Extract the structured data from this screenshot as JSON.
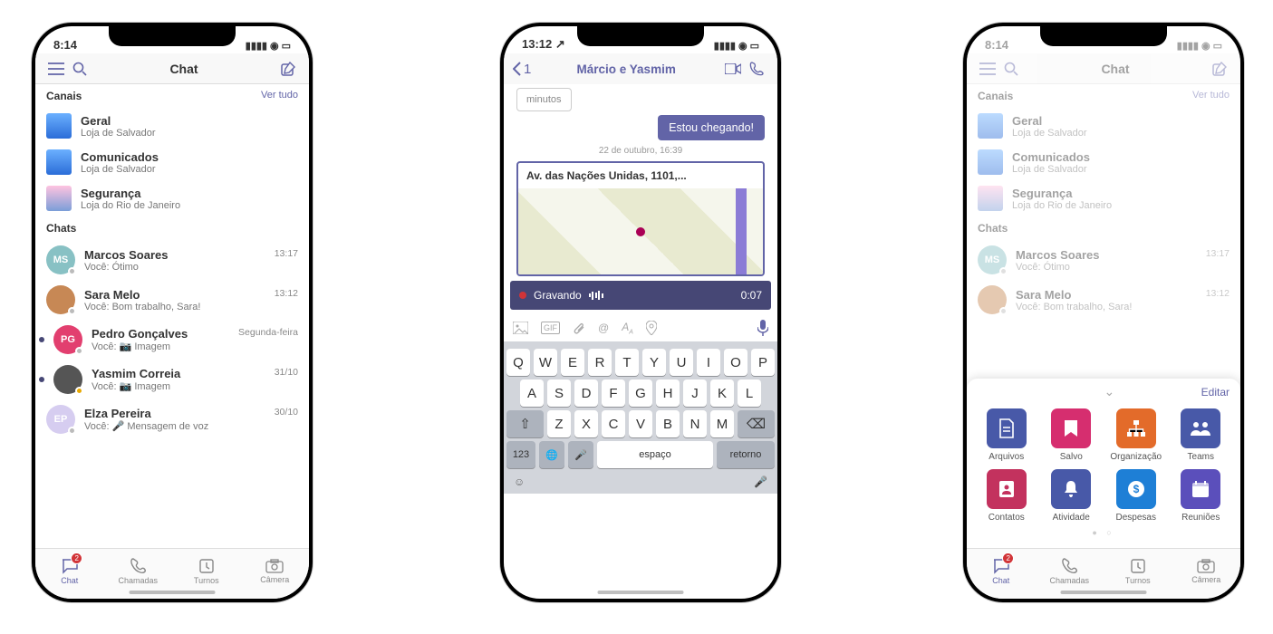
{
  "phone1": {
    "status_time": "8:14",
    "header_title": "Chat",
    "sections": {
      "channels_label": "Canais",
      "channels_link": "Ver tudo",
      "chats_label": "Chats"
    },
    "channels": [
      {
        "name": "Geral",
        "sub": "Loja de Salvador",
        "avatarClass": "blue"
      },
      {
        "name": "Comunicados",
        "sub": "Loja de Salvador",
        "avatarClass": "blue"
      },
      {
        "name": "Segurança",
        "sub": "Loja do Rio de Janeiro",
        "avatarClass": "pink"
      }
    ],
    "chats": [
      {
        "name": "Marcos Soares",
        "preview": "Você: Ótimo",
        "time": "13:17",
        "initials": "MS",
        "bg": "#88c1c4"
      },
      {
        "name": "Sara Melo",
        "preview": "Você: Bom trabalho, Sara!",
        "time": "13:12",
        "initials": "",
        "bg": "#c78855",
        "photo": true
      },
      {
        "name": "Pedro Gonçalves",
        "preview": "Você: 📷 Imagem",
        "time": "Segunda-feira",
        "initials": "PG",
        "bg": "#e23f6f",
        "dot": true
      },
      {
        "name": "Yasmim Correia",
        "preview": "Você: 📷 Imagem",
        "time": "31/10",
        "initials": "",
        "bg": "#555",
        "photo": true,
        "presence": "warn",
        "dot": true
      },
      {
        "name": "Elza Pereira",
        "preview": "Você: 🎤 Mensagem de voz",
        "time": "30/10",
        "initials": "EP",
        "bg": "#d6cdf0"
      }
    ],
    "tabs": [
      {
        "label": "Chat",
        "icon": "chat",
        "badge": "2",
        "active": true
      },
      {
        "label": "Chamadas",
        "icon": "call"
      },
      {
        "label": "Turnos",
        "icon": "shifts"
      },
      {
        "label": "Câmera",
        "icon": "camera"
      }
    ]
  },
  "phone2": {
    "status_time": "13:12",
    "back_count": "1",
    "header_title": "Márcio e Yasmim",
    "prev_bubble": "minutos",
    "sent_bubble": "Estou chegando!",
    "timestamp": "22 de outubro, 16:39",
    "map_address": "Av. das Nações Unidas, 1101,...",
    "recording_label": "Gravando",
    "recording_duration": "0:07",
    "keyboard": {
      "row1": [
        "Q",
        "W",
        "E",
        "R",
        "T",
        "Y",
        "U",
        "I",
        "O",
        "P"
      ],
      "row2": [
        "A",
        "S",
        "D",
        "F",
        "G",
        "H",
        "J",
        "K",
        "L"
      ],
      "row3": [
        "Z",
        "X",
        "C",
        "V",
        "B",
        "N",
        "M"
      ],
      "num_key": "123",
      "space_key": "espaço",
      "return_key": "retorno"
    }
  },
  "phone3": {
    "status_time": "8:14",
    "edit_label": "Editar",
    "apps": [
      {
        "label": "Arquivos",
        "color": "#4859a8",
        "icon": "file"
      },
      {
        "label": "Salvo",
        "color": "#d62e6f",
        "icon": "bookmark"
      },
      {
        "label": "Organização",
        "color": "#e36b2a",
        "icon": "org"
      },
      {
        "label": "Teams",
        "color": "#4859a8",
        "icon": "teams"
      },
      {
        "label": "Contatos",
        "color": "#c3325e",
        "icon": "contacts"
      },
      {
        "label": "Atividade",
        "color": "#4859a8",
        "icon": "bell"
      },
      {
        "label": "Despesas",
        "color": "#1e7fd6",
        "icon": "money"
      },
      {
        "label": "Reuniões",
        "color": "#5b4fbb",
        "icon": "calendar"
      }
    ]
  },
  "common": {
    "header_title": "Chat"
  }
}
